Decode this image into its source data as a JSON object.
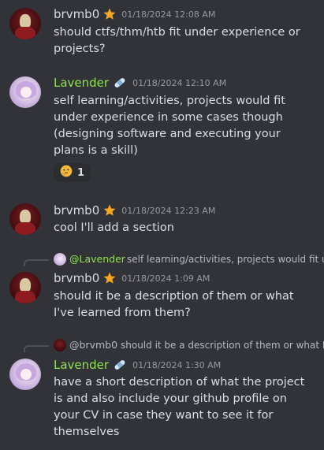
{
  "users": {
    "brvmb0": {
      "name": "brvmb0",
      "color": "#d7dae0",
      "badge_icon": "star-icon"
    },
    "lavender": {
      "name": "Lavender",
      "color": "#8fe34f",
      "badge_icon": "bandage-icon"
    }
  },
  "messages": [
    {
      "author": "brvmb0",
      "timestamp": "01/18/2024 12:08 AM",
      "text": "should ctfs/thm/htb fit under experience or projects?"
    },
    {
      "author": "Lavender",
      "timestamp": "01/18/2024 12:10 AM",
      "text": "self learning/activities, projects would fit under experience in some cases though (designing software and executing your plans is a skill)",
      "reaction": {
        "emoji_icon": "thinking-face-icon",
        "count": "1"
      }
    },
    {
      "author": "brvmb0",
      "timestamp": "01/18/2024 12:23 AM",
      "text": "cool I'll add a section"
    },
    {
      "reply_to": {
        "name": "@Lavender",
        "text": "self learning/activities, projects would fit under experience in some cases though"
      },
      "author": "brvmb0",
      "timestamp": "01/18/2024 1:09 AM",
      "text": "should it be a description of them or what I've learned from them?"
    },
    {
      "reply_to": {
        "name": "@brvmb0",
        "text": "should it be a description of them or what I've learned from them?"
      },
      "author": "Lavender",
      "timestamp": "01/18/2024 1:30 AM",
      "text": "have a short description of what the project is and also include your github profile on your CV in case they want to see it for themselves"
    }
  ]
}
